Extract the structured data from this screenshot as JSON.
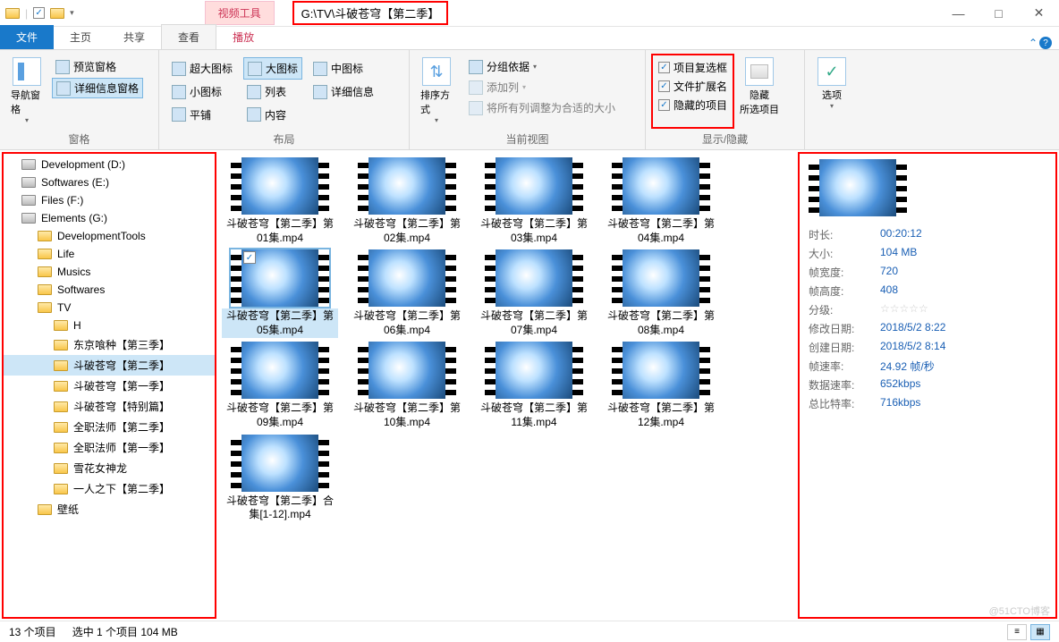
{
  "title_path": "G:\\TV\\斗破苍穹【第二季】",
  "title_tab": "视频工具",
  "qat_checked": true,
  "win": {
    "min": "—",
    "max": "□",
    "close": "✕"
  },
  "tabs": {
    "file": "文件",
    "home": "主页",
    "share": "共享",
    "view": "查看",
    "play": "播放"
  },
  "ribbon": {
    "panes": {
      "nav": "导航窗格",
      "preview": "预览窗格",
      "detailpane": "详细信息窗格",
      "panes_label": "窗格",
      "layout_label": "布局",
      "layouts": [
        "超大图标",
        "大图标",
        "中图标",
        "小图标",
        "列表",
        "详细信息",
        "平铺",
        "内容"
      ],
      "current_view_label": "当前视图",
      "sort": "排序方式",
      "groupby": "分组依据",
      "addcol": "添加列",
      "autofit": "将所有列调整为合适的大小",
      "showhide_label": "显示/隐藏",
      "chk_items": "项目复选框",
      "chk_ext": "文件扩展名",
      "chk_hidden": "隐藏的项目",
      "hide_sel": "隐藏\n所选项目",
      "options": "选项"
    }
  },
  "tree": [
    {
      "lvl": 1,
      "ico": "drive",
      "name": "Development (D:)"
    },
    {
      "lvl": 1,
      "ico": "drive",
      "name": "Softwares (E:)"
    },
    {
      "lvl": 1,
      "ico": "drive",
      "name": "Files (F:)"
    },
    {
      "lvl": 1,
      "ico": "drive",
      "name": "Elements (G:)"
    },
    {
      "lvl": 2,
      "ico": "fold",
      "name": "DevelopmentTools"
    },
    {
      "lvl": 2,
      "ico": "fold",
      "name": "Life"
    },
    {
      "lvl": 2,
      "ico": "fold",
      "name": "Musics"
    },
    {
      "lvl": 2,
      "ico": "fold",
      "name": "Softwares"
    },
    {
      "lvl": 2,
      "ico": "fold",
      "name": "TV"
    },
    {
      "lvl": 3,
      "ico": "fold",
      "name": "H"
    },
    {
      "lvl": 3,
      "ico": "fold",
      "name": "东京喰种【第三季】"
    },
    {
      "lvl": 3,
      "ico": "fold",
      "name": "斗破苍穹【第二季】",
      "sel": true
    },
    {
      "lvl": 3,
      "ico": "fold",
      "name": "斗破苍穹【第一季】"
    },
    {
      "lvl": 3,
      "ico": "fold",
      "name": "斗破苍穹【特别篇】"
    },
    {
      "lvl": 3,
      "ico": "fold",
      "name": "全职法师【第二季】"
    },
    {
      "lvl": 3,
      "ico": "fold",
      "name": "全职法师【第一季】"
    },
    {
      "lvl": 3,
      "ico": "fold",
      "name": "雪花女神龙"
    },
    {
      "lvl": 3,
      "ico": "fold",
      "name": "一人之下【第二季】"
    },
    {
      "lvl": 2,
      "ico": "fold",
      "name": "壁纸"
    }
  ],
  "files": [
    "斗破苍穹【第二季】第01集.mp4",
    "斗破苍穹【第二季】第02集.mp4",
    "斗破苍穹【第二季】第03集.mp4",
    "斗破苍穹【第二季】第04集.mp4",
    "斗破苍穹【第二季】第05集.mp4",
    "斗破苍穹【第二季】第06集.mp4",
    "斗破苍穹【第二季】第07集.mp4",
    "斗破苍穹【第二季】第08集.mp4",
    "斗破苍穹【第二季】第09集.mp4",
    "斗破苍穹【第二季】第10集.mp4",
    "斗破苍穹【第二季】第11集.mp4",
    "斗破苍穹【第二季】第12集.mp4",
    "斗破苍穹【第二季】合集[1-12].mp4"
  ],
  "selected_index": 4,
  "details": {
    "时长:": "00:20:12",
    "大小:": "104 MB",
    "帧宽度:": "720",
    "帧高度:": "408",
    "分级:": "☆☆☆☆☆",
    "修改日期:": "2018/5/2 8:22",
    "创建日期:": "2018/5/2 8:14",
    "帧速率:": "24.92 帧/秒",
    "数据速率:": "652kbps",
    "总比特率:": "716kbps"
  },
  "status": {
    "count": "13 个项目",
    "sel": "选中 1 个项目  104 MB"
  },
  "watermark": "@51CTO博客"
}
